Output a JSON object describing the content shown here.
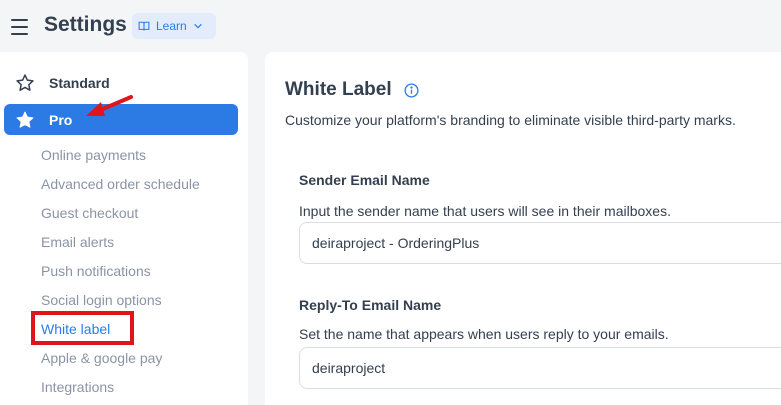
{
  "header": {
    "title": "Settings",
    "learn_label": "Learn"
  },
  "sidebar": {
    "standard_label": "Standard",
    "pro_label": "Pro",
    "sub_items": [
      {
        "label": "Online payments"
      },
      {
        "label": "Advanced order schedule"
      },
      {
        "label": "Guest checkout"
      },
      {
        "label": "Email alerts"
      },
      {
        "label": "Push notifications"
      },
      {
        "label": "Social login options"
      },
      {
        "label": "White label"
      },
      {
        "label": "Apple & google pay"
      },
      {
        "label": "Integrations"
      }
    ]
  },
  "main": {
    "title": "White Label",
    "description": "Customize your platform's branding to eliminate visible third-party marks.",
    "sender": {
      "label": "Sender Email Name",
      "help": "Input the sender name that users will see in their mailboxes.",
      "value": "deiraproject - OrderingPlus"
    },
    "reply": {
      "label": "Reply-To Email Name",
      "help": "Set the name that appears when users reply to your emails.",
      "value": "deiraproject"
    }
  },
  "colors": {
    "accent": "#2c7be5",
    "annotation_red": "#e0141b"
  }
}
